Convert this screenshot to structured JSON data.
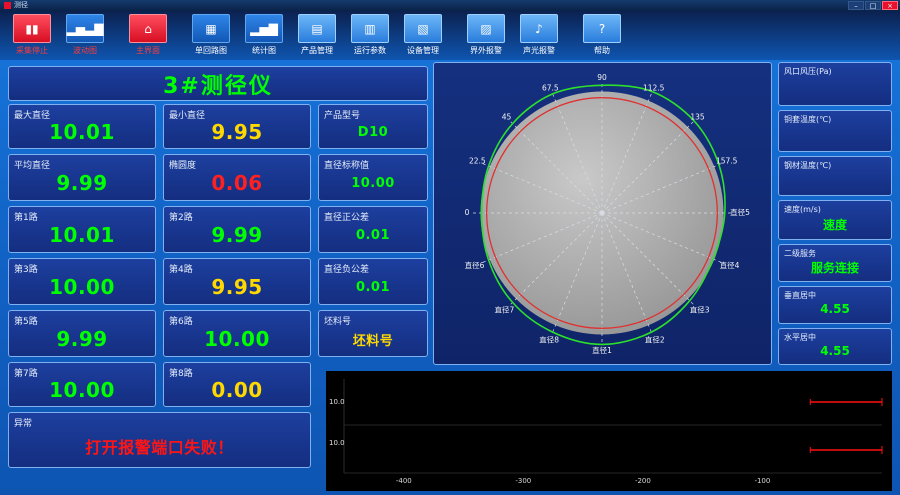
{
  "window": {
    "title": "测径",
    "minimize_label": "–",
    "maximize_label": "□",
    "close_label": "×"
  },
  "toolbar": {
    "buttons": [
      {
        "name": "stop-collection",
        "label": "采集停止",
        "icon": "▮▮",
        "style": "red",
        "label_color": "#ff3b3b",
        "gap_before": false
      },
      {
        "name": "wave-chart",
        "label": "波动图",
        "icon": "▂▅▃▇",
        "style": "blue",
        "label_color": "#ff3b3b",
        "gap_before": false
      },
      {
        "name": "main-screen",
        "label": "主界面",
        "icon": "⌂",
        "style": "red",
        "label_color": "#ff3b3b",
        "gap_before": true
      },
      {
        "name": "single-loop-chart",
        "label": "单回路图",
        "icon": "▦",
        "style": "blue",
        "label_color": "#ffffff",
        "gap_before": true
      },
      {
        "name": "statistics-chart",
        "label": "统计图",
        "icon": "▂▅▇",
        "style": "blue",
        "label_color": "#ffffff",
        "gap_before": false
      },
      {
        "name": "product-management",
        "label": "产品管理",
        "icon": "▤",
        "style": "lightblue",
        "label_color": "#ffffff",
        "gap_before": false
      },
      {
        "name": "run-parameters",
        "label": "运行参数",
        "icon": "▥",
        "style": "lightblue",
        "label_color": "#ffffff",
        "gap_before": false
      },
      {
        "name": "device-management",
        "label": "设备管理",
        "icon": "▧",
        "style": "lightblue",
        "label_color": "#ffffff",
        "gap_before": false
      },
      {
        "name": "out-of-tolerance-alarm",
        "label": "界外报警",
        "icon": "▨",
        "style": "lightblue",
        "label_color": "#ffffff",
        "gap_before": true
      },
      {
        "name": "sound-light-alarm",
        "label": "声光报警",
        "icon": "♪",
        "style": "lightblue",
        "label_color": "#ffffff",
        "gap_before": false
      },
      {
        "name": "help",
        "label": "帮助",
        "icon": "?",
        "style": "lightblue",
        "label_color": "#ffffff",
        "gap_before": true
      }
    ]
  },
  "gauge": {
    "title": "3#测径仪",
    "title_color": "#00ff00",
    "max_diameter": {
      "label": "最大直径",
      "value": "10.01",
      "color": "#00ff00"
    },
    "min_diameter": {
      "label": "最小直径",
      "value": "9.95",
      "color": "#ffd800"
    },
    "product_model": {
      "label": "产品型号",
      "value": "D10",
      "color": "#00ff00"
    },
    "avg_diameter": {
      "label": "平均直径",
      "value": "9.99",
      "color": "#00ff00"
    },
    "ovality": {
      "label": "椭圆度",
      "value": "0.06",
      "color": "#ff2020"
    },
    "nominal_diameter": {
      "label": "直径标称值",
      "value": "10.00",
      "color": "#00ff00"
    },
    "ch1": {
      "label": "第1路",
      "value": "10.01",
      "color": "#00ff00"
    },
    "ch2": {
      "label": "第2路",
      "value": "9.99",
      "color": "#00ff00"
    },
    "tol_plus": {
      "label": "直径正公差",
      "value": "0.01",
      "color": "#00ff00"
    },
    "ch3": {
      "label": "第3路",
      "value": "10.00",
      "color": "#00ff00"
    },
    "ch4": {
      "label": "第4路",
      "value": "9.95",
      "color": "#ffd800"
    },
    "tol_minus": {
      "label": "直径负公差",
      "value": "0.01",
      "color": "#00ff00"
    },
    "ch5": {
      "label": "第5路",
      "value": "9.99",
      "color": "#00ff00"
    },
    "ch6": {
      "label": "第6路",
      "value": "10.00",
      "color": "#00ff00"
    },
    "billet_no": {
      "label": "坯料号",
      "value": "坯料号",
      "color": "#ffd800"
    },
    "ch7": {
      "label": "第7路",
      "value": "10.00",
      "color": "#00ff00"
    },
    "ch8": {
      "label": "第8路",
      "value": "0.00",
      "color": "#ffd800"
    },
    "abnormal": {
      "label": "异常",
      "value": "打开报警端口失败！",
      "color": "#ff1515"
    }
  },
  "status": {
    "wind_pressure": {
      "label": "风口风压(Pa)",
      "value": "",
      "color": "#00ff00"
    },
    "sleeve_temp": {
      "label": "铜套温度(℃)",
      "value": "",
      "color": "#00ff00"
    },
    "steel_temp": {
      "label": "钢材温度(℃)",
      "value": "",
      "color": "#00ff00"
    },
    "speed": {
      "label": "速度(m/s)",
      "value": "速度",
      "color": "#00ff00"
    },
    "server": {
      "label": "二级服务",
      "value": "服务连接",
      "color": "#00ff00"
    },
    "vertical_center": {
      "label": "垂直居中",
      "value": "4.55",
      "color": "#00ff00"
    },
    "horizontal_center": {
      "label": "水平居中",
      "value": "4.55",
      "color": "#00ff00"
    }
  },
  "chart_data": [
    {
      "type": "polar-profile",
      "title": "cross-section profile of measured bar",
      "angle_labels": [
        {
          "text": "0",
          "deg": 180
        },
        {
          "text": "22.5",
          "deg": 157.5
        },
        {
          "text": "45",
          "deg": 135
        },
        {
          "text": "67.5",
          "deg": 112.5
        },
        {
          "text": "90",
          "deg": 90
        },
        {
          "text": "112.5",
          "deg": 67.5
        },
        {
          "text": "135",
          "deg": 45
        },
        {
          "text": "157.5",
          "deg": 22.5
        }
      ],
      "diameter_labels": [
        {
          "text": "直径5",
          "deg": 0
        },
        {
          "text": "直径4",
          "deg": -22.5
        },
        {
          "text": "直径3",
          "deg": -45
        },
        {
          "text": "直径2",
          "deg": -67.5
        },
        {
          "text": "直径1",
          "deg": -90
        },
        {
          "text": "直径8",
          "deg": -112.5
        },
        {
          "text": "直径7",
          "deg": -135
        },
        {
          "text": "直径6",
          "deg": -157.5
        }
      ],
      "disc_color_inner": "#c9c9c9",
      "disc_color_outer": "#8f8f8f",
      "red_circle": {
        "color": "#e03030",
        "radius_ratio": 0.93
      },
      "green_profile": {
        "color": "#2ce02c",
        "radii_ratio": [
          0.99,
          1.02,
          1.05,
          1.06,
          1.03,
          1.04,
          1.02,
          0.99,
          0.97,
          0.99,
          1.02,
          1.04,
          1.06,
          1.04,
          1.0,
          0.97
        ]
      }
    },
    {
      "type": "line",
      "title": "diameter vs length trend",
      "background": "#000000",
      "x_ticks": [
        "-400",
        "-300",
        "-200",
        "-100"
      ],
      "x_domain": [
        -450,
        0
      ],
      "panels": [
        {
          "y_label": "10.0",
          "color": "#ff1010",
          "points": [
            [
              -60,
              10.0
            ],
            [
              0,
              10.0
            ]
          ]
        },
        {
          "y_label": "10.0",
          "color": "#ff1010",
          "points": [
            [
              -60,
              10.0
            ],
            [
              0,
              10.0
            ]
          ]
        }
      ]
    }
  ]
}
